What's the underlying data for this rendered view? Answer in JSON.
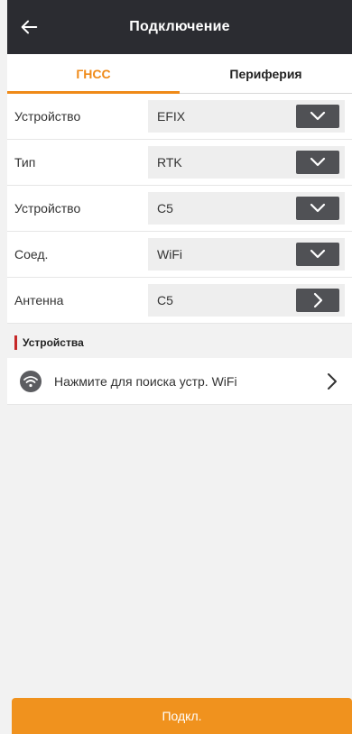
{
  "header": {
    "title": "Подключение",
    "back_icon": "arrow-left-icon"
  },
  "tabs": [
    {
      "label": "ГНСС",
      "active": true
    },
    {
      "label": "Периферия",
      "active": false
    }
  ],
  "form": {
    "rows": [
      {
        "label": "Устройство",
        "value": "EFIX",
        "control": "chevron-down-icon"
      },
      {
        "label": "Тип",
        "value": "RTK",
        "control": "chevron-down-icon"
      },
      {
        "label": "Устройство",
        "value": "C5",
        "control": "chevron-down-icon"
      },
      {
        "label": "Соед.",
        "value": "WiFi",
        "control": "chevron-down-icon"
      },
      {
        "label": "Антенна",
        "value": "C5",
        "control": "chevron-right-icon"
      }
    ]
  },
  "section": {
    "title": "Устройства"
  },
  "search": {
    "label": "Нажмите для поиска устр. WiFi",
    "icon": "wifi-icon"
  },
  "footer": {
    "connect_label": "Подкл."
  },
  "colors": {
    "header_bg": "#2b2c31",
    "accent": "#ef8a18",
    "button_bg": "#f0921e",
    "section_marker": "#c62828"
  }
}
